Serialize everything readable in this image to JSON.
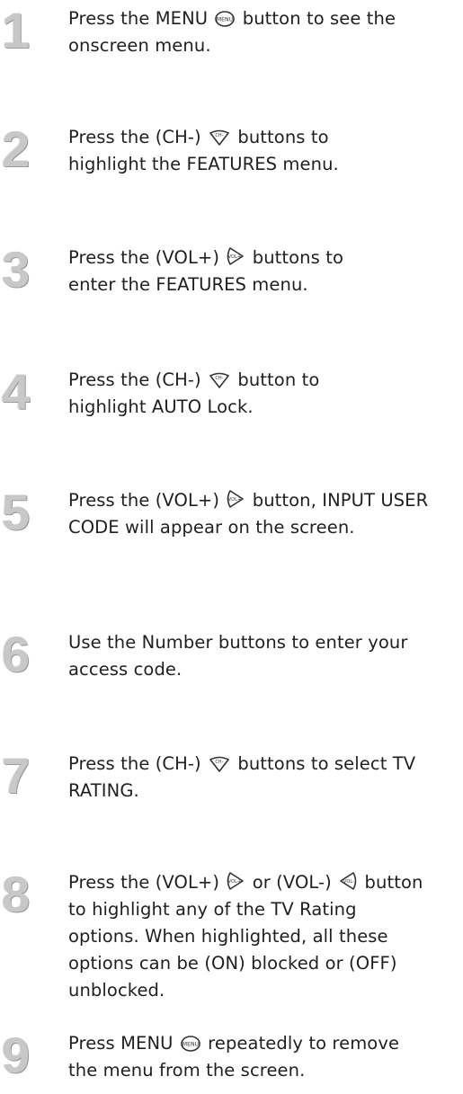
{
  "steps": [
    {
      "number": "1",
      "parts": [
        "Press the MENU",
        "button to see the onscreen menu."
      ],
      "icons": [
        "menu-button-icon"
      ]
    },
    {
      "number": "2",
      "parts": [
        "Press the (CH-)",
        "buttons to highlight the FEATURES menu."
      ],
      "icons": [
        "ch-minus-button-icon"
      ]
    },
    {
      "number": "3",
      "parts": [
        "Press the (VOL+)",
        "buttons to enter the FEATURES menu."
      ],
      "icons": [
        "vol-plus-button-icon"
      ]
    },
    {
      "number": "4",
      "parts": [
        "Press the (CH-)",
        "button to highlight AUTO Lock."
      ],
      "icons": [
        "ch-minus-button-icon"
      ]
    },
    {
      "number": "5",
      "parts": [
        "Press the  (VOL+)",
        "button, INPUT USER CODE will appear on the screen."
      ],
      "icons": [
        "vol-plus-button-icon"
      ]
    },
    {
      "number": "6",
      "parts": [
        "Use the Number buttons to enter your access code."
      ],
      "icons": []
    },
    {
      "number": "7",
      "parts": [
        "Press the (CH-)",
        "buttons to select TV RATING."
      ],
      "icons": [
        "ch-minus-button-icon"
      ]
    },
    {
      "number": "8",
      "parts": [
        "Press the (VOL+)",
        "or (VOL-)",
        "button to highlight any of the TV Rating options. When highlighted, all these options can be (ON) blocked or (OFF) unblocked."
      ],
      "icons": [
        "vol-plus-button-icon",
        "vol-minus-button-icon"
      ]
    },
    {
      "number": "9",
      "parts": [
        "Press MENU",
        "repeatedly to remove the menu from the screen."
      ],
      "icons": [
        "menu-button-icon"
      ]
    }
  ],
  "icon_labels": {
    "menu": "MENU",
    "ch_minus": "CH-",
    "vol_plus": "VOL+",
    "vol_minus": "VOL-"
  },
  "colors": {
    "step_number": "#c8c8c8",
    "text": "#1f1f1f"
  }
}
